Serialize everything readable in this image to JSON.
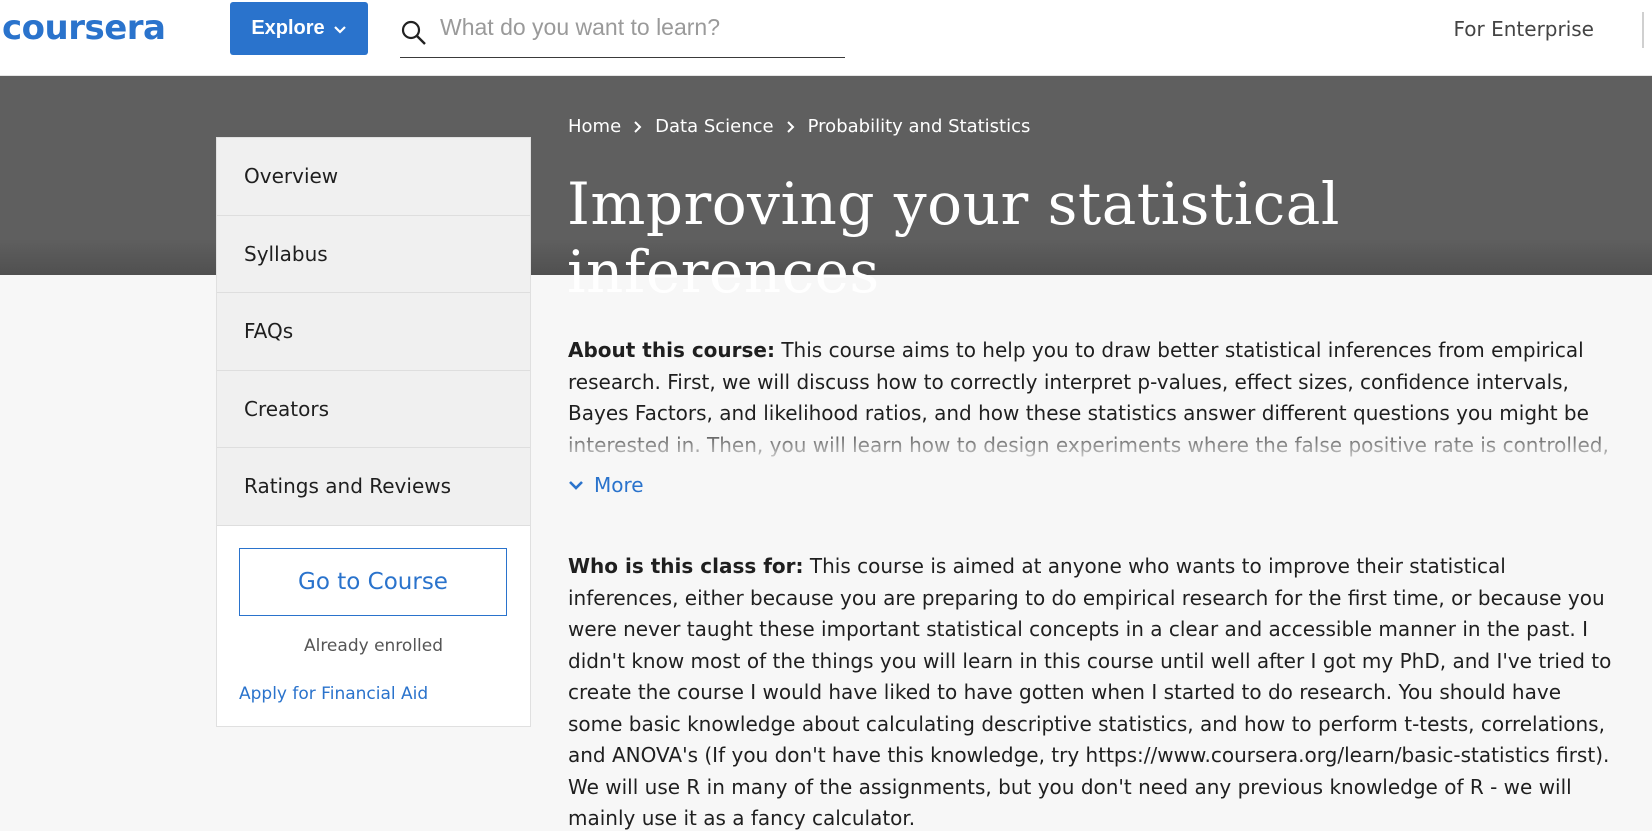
{
  "header": {
    "logo_text": "coursera",
    "explore_label": "Explore",
    "search_placeholder": "What do you want to learn?",
    "enterprise_label": "For Enterprise"
  },
  "breadcrumb": [
    {
      "label": "Home"
    },
    {
      "label": "Data Science"
    },
    {
      "label": "Probability and Statistics"
    }
  ],
  "course": {
    "title": "Improving your statistical inferences"
  },
  "sidebar": {
    "items": [
      {
        "label": "Overview"
      },
      {
        "label": "Syllabus"
      },
      {
        "label": "FAQs"
      },
      {
        "label": "Creators"
      },
      {
        "label": "Ratings and Reviews"
      }
    ],
    "go_to_course_label": "Go to Course",
    "enrolled_text": "Already enrolled",
    "financial_aid_label": "Apply for Financial Aid"
  },
  "main": {
    "about_label": "About this course:",
    "about_text": "This course aims to help you to draw better statistical inferences from empirical research. First, we will discuss how to correctly interpret p-values, effect sizes, confidence intervals, Bayes Factors, and likelihood ratios, and how these statistics answer different questions you might be interested in. Then, you will learn how to design experiments where the false positive rate is controlled, and how to",
    "more_label": "More",
    "who_label": "Who is this class for:",
    "who_text": "This course is aimed at anyone who wants to improve their statistical inferences, either because you are preparing to do empirical research for the first time, or because you were never taught these important statistical concepts in a clear and accessible manner in the past. I didn't know most of the things you will learn in this course until well after I got my PhD, and I've tried to create the course I would have liked to have gotten when I started to do research. You should have some basic knowledge about calculating descriptive statistics, and how to perform t-tests, correlations, and ANOVA's (If you don't have this knowledge, try https://www.coursera.org/learn/basic-statistics first). We will use R in many of the assignments, but you don't need any previous knowledge of R - we will mainly use it as a fancy calculator."
  },
  "colors": {
    "brand_blue": "#2a73cc",
    "hero_gray": "#5f5f5f",
    "page_bg": "#f7f7f7"
  }
}
